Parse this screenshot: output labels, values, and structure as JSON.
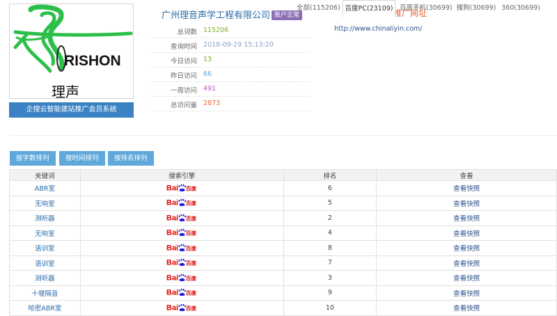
{
  "logo": {
    "brand_text": "RISHON",
    "brand_chinese": "理声",
    "banner": "企搜云智能建站推广会员系统"
  },
  "company": {
    "name": "广州理音声学工程有限公司",
    "status": "账户正常"
  },
  "stats": [
    {
      "label": "总词数",
      "value": "115206",
      "color": "#7ab41d"
    },
    {
      "label": "查询时间",
      "value": "2018-09-29 15:13:20",
      "color": "#8aa4c4"
    },
    {
      "label": "今日访问",
      "value": "13",
      "color": "#7ab41d"
    },
    {
      "label": "昨日访问",
      "value": "66",
      "color": "#5aa3d6"
    },
    {
      "label": "一周访问",
      "value": "491",
      "color": "#b45ab4"
    },
    {
      "label": "总访问量",
      "value": "2873",
      "color": "#e8673c"
    }
  ],
  "promo": {
    "title": "推广网址",
    "url": "http://www.chinaliyin.com/"
  },
  "sort_buttons": [
    "按字数排列",
    "按时间排列",
    "按排名排列"
  ],
  "tabs": [
    {
      "label": "全部(115206)",
      "active": false
    },
    {
      "label": "百度PC(23109)",
      "active": true
    },
    {
      "label": "百度手机(30699)",
      "active": false
    },
    {
      "label": "搜狗(30699)",
      "active": false
    },
    {
      "label": "360(30699)",
      "active": false
    }
  ],
  "table": {
    "headers": [
      "关键词",
      "搜索引擎",
      "排名",
      "查看"
    ],
    "engine_logo": {
      "text_bai": "Bai",
      "text_cn": "百度"
    },
    "rows": [
      {
        "keyword": "ABR室",
        "rank": "6",
        "action": "查看快照"
      },
      {
        "keyword": "无响室",
        "rank": "5",
        "action": "查看快照"
      },
      {
        "keyword": "测听器",
        "rank": "2",
        "action": "查看快照"
      },
      {
        "keyword": "无响室",
        "rank": "4",
        "action": "查看快照"
      },
      {
        "keyword": "语训室",
        "rank": "8",
        "action": "查看快照"
      },
      {
        "keyword": "语训室",
        "rank": "7",
        "action": "查看快照"
      },
      {
        "keyword": "测听器",
        "rank": "3",
        "action": "查看快照"
      },
      {
        "keyword": "十堰隔音",
        "rank": "9",
        "action": "查看快照"
      },
      {
        "keyword": "哈密ABR室",
        "rank": "10",
        "action": "查看快照"
      }
    ]
  },
  "colors": {
    "accent_blue": "#3a82c4",
    "button_blue": "#5fa8db",
    "baidu_red": "#e10601",
    "baidu_blue": "#2319dc"
  }
}
